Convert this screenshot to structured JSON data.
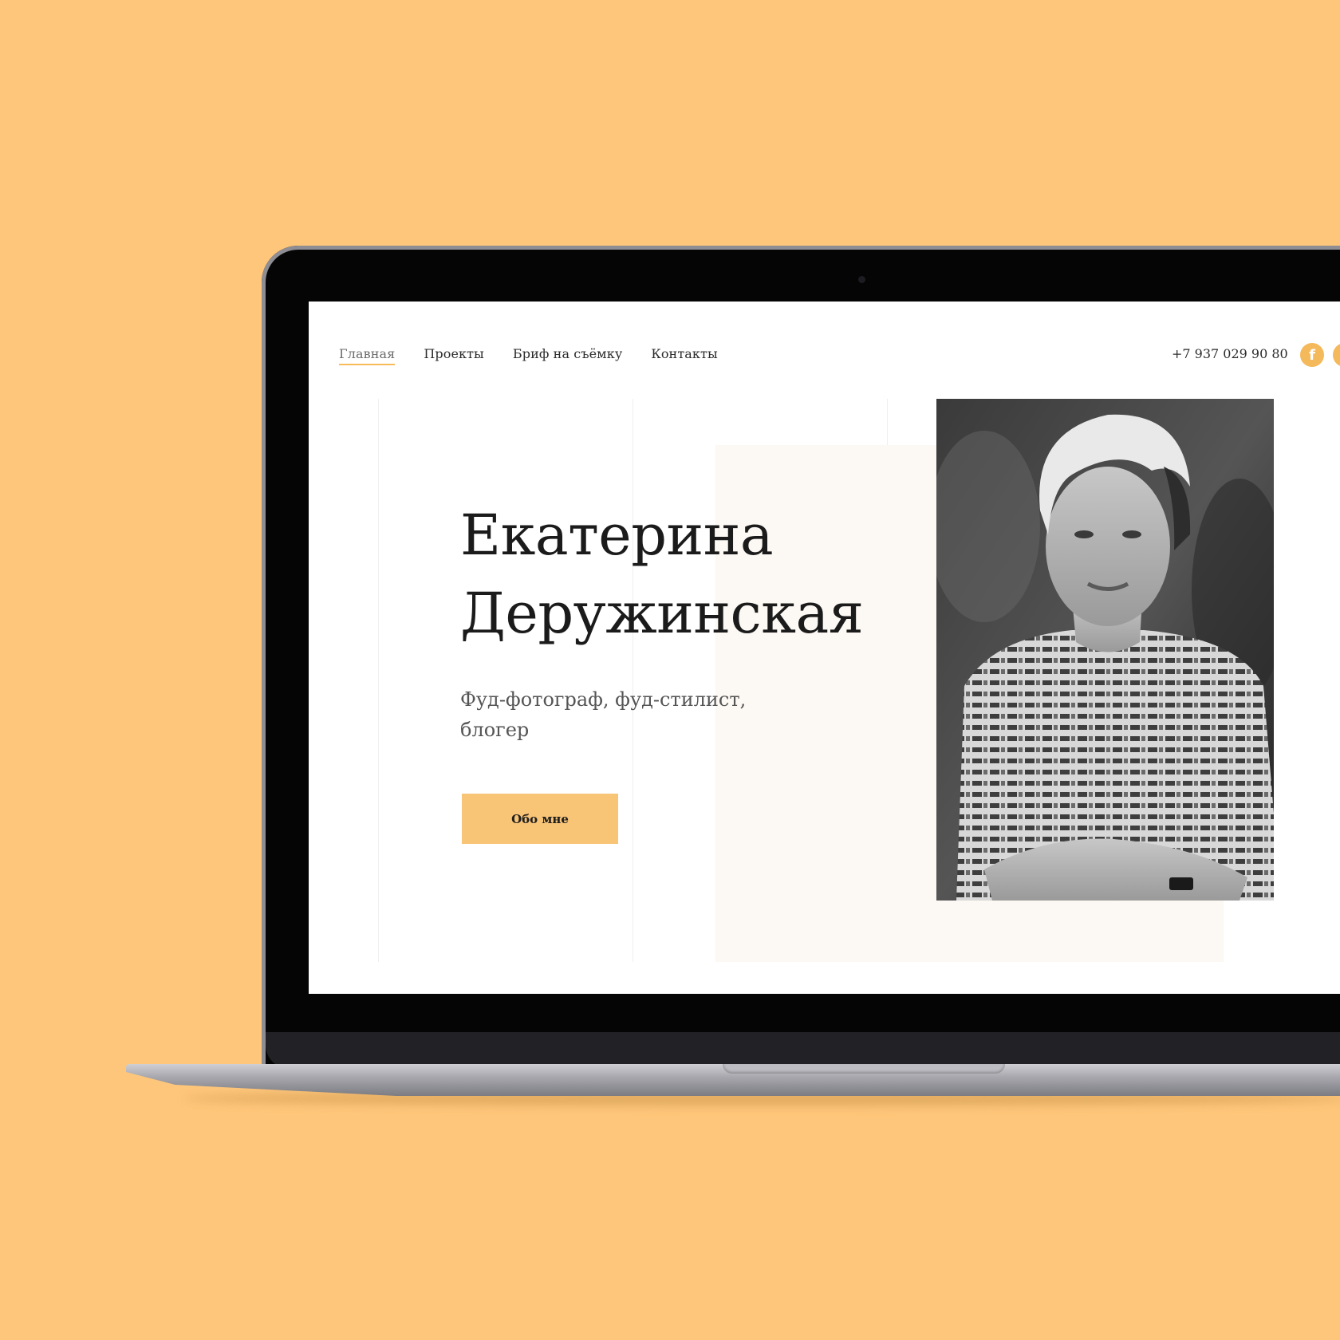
{
  "nav": {
    "items": [
      {
        "label": "Главная",
        "active": true
      },
      {
        "label": "Проекты",
        "active": false
      },
      {
        "label": "Бриф на съёмку",
        "active": false
      },
      {
        "label": "Контакты",
        "active": false
      }
    ]
  },
  "header": {
    "phone": "+7 937 029 90 80",
    "social": [
      {
        "icon": "facebook-icon",
        "glyph": "f"
      },
      {
        "icon": "social-icon"
      }
    ]
  },
  "hero": {
    "name_line1": "Екатерина",
    "name_line2": "Деружинская",
    "subtitle": "Фуд-фотограф, фуд-стилист, блогер",
    "button_label": "Обо мне",
    "portrait_icon": "portrait-photo"
  },
  "colors": {
    "background": "#fec67a",
    "accent": "#f8c476",
    "panel": "#fcf8f3",
    "text": "#1b1b1b"
  }
}
